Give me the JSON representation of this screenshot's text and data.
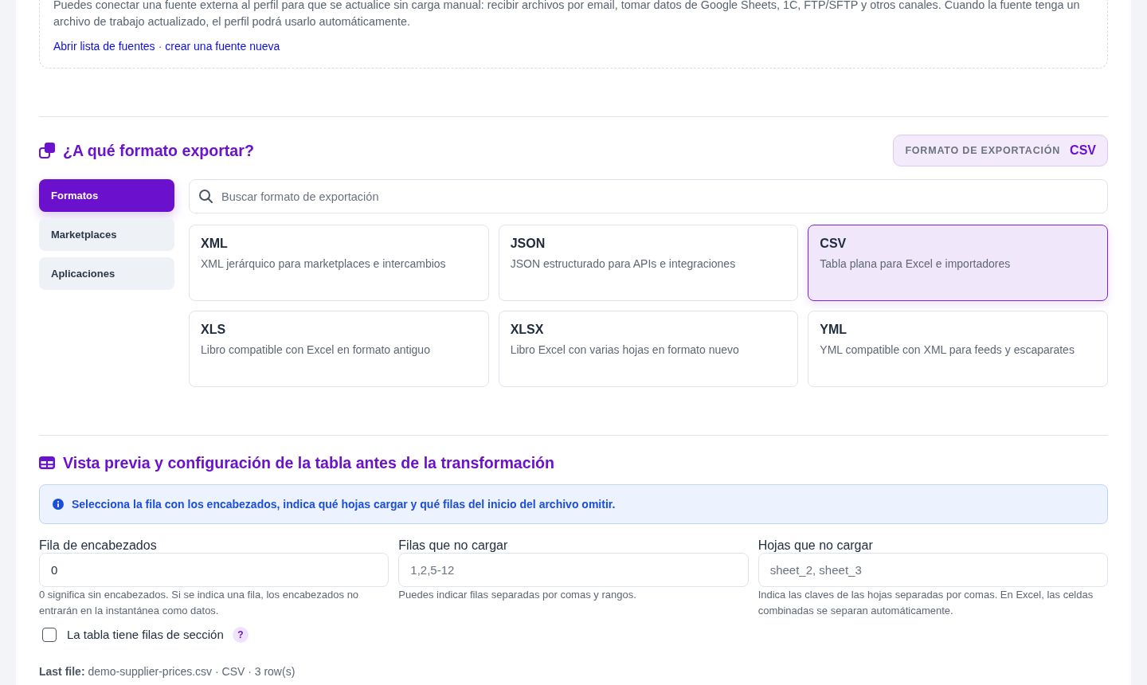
{
  "source_panel": {
    "description": "Puedes conectar una fuente externa al perfil para que se actualice sin carga manual: recibir archivos por email, tomar datos de Google Sheets, 1C, FTP/SFTP y otros canales. Cuando la fuente tenga un archivo de trabajo actualizado, el perfil podrá usarlo automáticamente.",
    "links": [
      {
        "label": "Abrir lista de fuentes"
      },
      {
        "label": "crear una fuente nueva"
      }
    ],
    "link_separator": "·"
  },
  "export_section": {
    "title": "¿A qué formato exportar?",
    "format_badge": {
      "label": "FORMATO DE EXPORTACIÓN",
      "value": "CSV"
    },
    "tabs": [
      {
        "label": "Formatos",
        "selected": true
      },
      {
        "label": "Marketplaces",
        "selected": false
      },
      {
        "label": "Aplicaciones",
        "selected": false
      }
    ],
    "search": {
      "placeholder": "Buscar formato de exportación"
    },
    "formats": [
      {
        "name": "XML",
        "description": "XML jerárquico para marketplaces e intercambios",
        "selected": false
      },
      {
        "name": "JSON",
        "description": "JSON estructurado para APIs e integraciones",
        "selected": false
      },
      {
        "name": "CSV",
        "description": "Tabla plana para Excel e importadores",
        "selected": true
      },
      {
        "name": "XLS",
        "description": "Libro compatible con Excel en formato antiguo",
        "selected": false
      },
      {
        "name": "XLSX",
        "description": "Libro Excel con varias hojas en formato nuevo",
        "selected": false
      },
      {
        "name": "YML",
        "description": "YML compatible con XML para feeds y escaparates",
        "selected": false
      }
    ]
  },
  "preview_section": {
    "title": "Vista previa y configuración de la tabla antes de la transformación",
    "alert": "Selecciona la fila con los encabezados, indica qué hojas cargar y qué filas del inicio del archivo omitir.",
    "fields": [
      {
        "label": "Fila de encabezados",
        "value": "0",
        "help": "0 significa sin encabezados. Si se indica una fila, los encabezados no entrarán en la instantánea como datos."
      },
      {
        "label": "Filas que no cargar",
        "placeholder": "1,2,5-12",
        "help": "Puedes indicar filas separadas por comas y rangos."
      },
      {
        "label": "Hojas que no cargar",
        "placeholder": "sheet_2, sheet_3",
        "help": "Indica las claves de las hojas separadas por comas. En Excel, las celdas combinadas se separan automáticamente."
      }
    ],
    "section_rows": {
      "label": "La tabla tiene filas de sección",
      "checked": false,
      "help_badge": "?"
    },
    "last_file": "**Last file:** demo-supplier-prices.csv · CSV · 3 row(s)"
  }
}
